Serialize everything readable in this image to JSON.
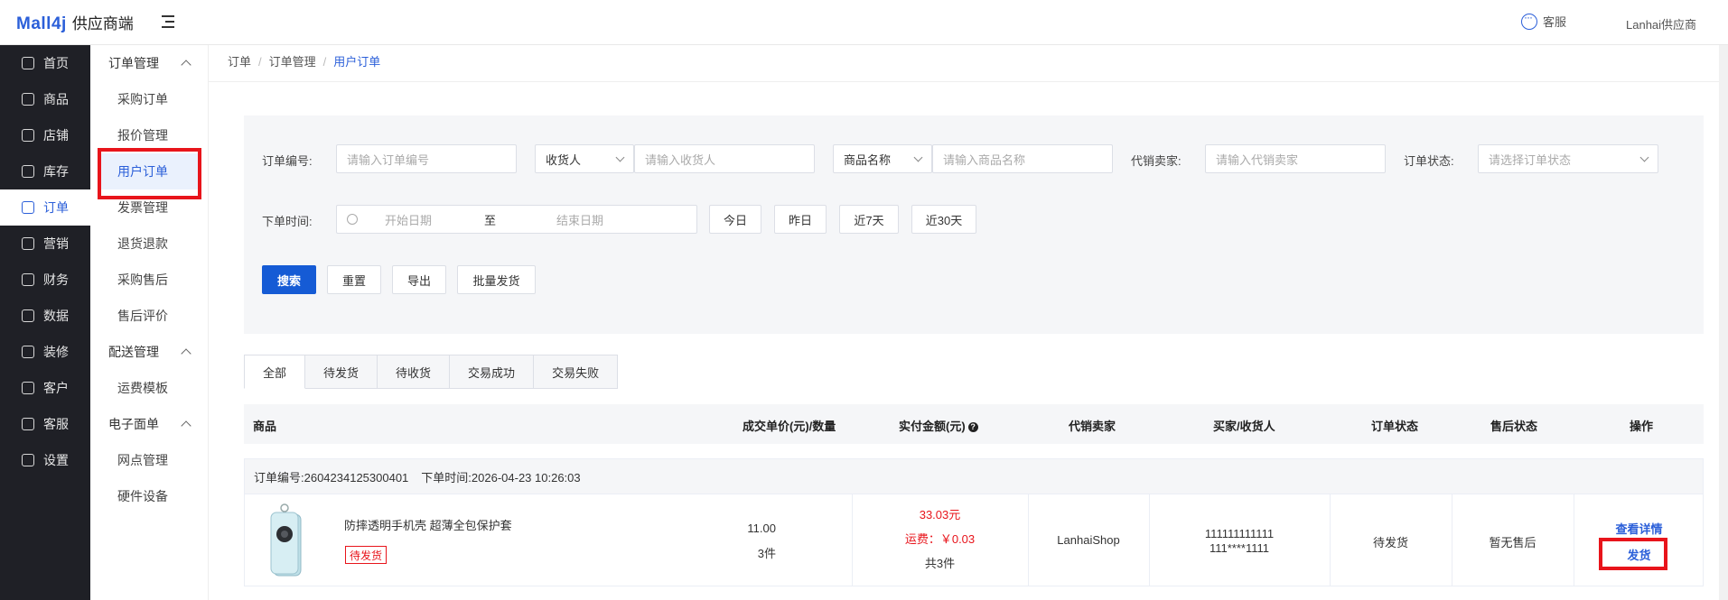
{
  "header": {
    "brand": "Mall4j",
    "brand_suffix": "供应商端",
    "service_label": "客服",
    "user_name": "Lanhai供应商"
  },
  "sidebar": {
    "items": [
      {
        "label": "首页",
        "icon": "home-icon"
      },
      {
        "label": "商品",
        "icon": "product-icon"
      },
      {
        "label": "店铺",
        "icon": "shop-icon"
      },
      {
        "label": "库存",
        "icon": "inventory-icon"
      },
      {
        "label": "订单",
        "icon": "order-icon",
        "active": true
      },
      {
        "label": "营销",
        "icon": "gift-icon"
      },
      {
        "label": "财务",
        "icon": "finance-icon"
      },
      {
        "label": "数据",
        "icon": "data-icon"
      },
      {
        "label": "装修",
        "icon": "decorate-icon"
      },
      {
        "label": "客户",
        "icon": "customer-icon"
      },
      {
        "label": "客服",
        "icon": "service-icon"
      },
      {
        "label": "设置",
        "icon": "settings-icon"
      }
    ]
  },
  "subnav": {
    "group1": "订单管理",
    "group1_items": [
      "采购订单",
      "报价管理",
      "用户订单",
      "发票管理",
      "退货退款",
      "采购售后",
      "售后评价"
    ],
    "group2": "配送管理",
    "group2_items": [
      "运费模板"
    ],
    "group3": "电子面单",
    "group3_items": [
      "网点管理",
      "硬件设备"
    ]
  },
  "breadcrumb": {
    "l1": "订单",
    "l2": "订单管理",
    "l3": "用户订单",
    "sep": "/"
  },
  "filters": {
    "order_no_label": "订单编号:",
    "order_no_placeholder": "请输入订单编号",
    "receiver_select": "收货人",
    "receiver_placeholder": "请输入收货人",
    "product_select": "商品名称",
    "product_placeholder": "请输入商品名称",
    "seller_label": "代销卖家:",
    "seller_placeholder": "请输入代销卖家",
    "status_label": "订单状态:",
    "status_placeholder": "请选择订单状态",
    "time_label": "下单时间:",
    "start_placeholder": "开始日期",
    "range_sep": "至",
    "end_placeholder": "结束日期",
    "quick": [
      "今日",
      "昨日",
      "近7天",
      "近30天"
    ],
    "search": "搜索",
    "reset": "重置",
    "export": "导出",
    "batch_ship": "批量发货"
  },
  "tabs": [
    "全部",
    "待发货",
    "待收货",
    "交易成功",
    "交易失败"
  ],
  "table": {
    "headers": {
      "product": "商品",
      "price_qty": "成交单价(元)/数量",
      "paid": "实付金额(元)",
      "seller": "代销卖家",
      "buyer": "买家/收货人",
      "status": "订单状态",
      "after_sale": "售后状态",
      "ops": "操作"
    },
    "order": {
      "order_no": "订单编号:2604234125300401",
      "order_time": "下单时间:2026-04-23 10:26:03",
      "product_name": "防摔透明手机壳 超薄全包保护套",
      "product_tag": "待发货",
      "unit_price": "11.00",
      "quantity": "3件",
      "paid_amount": "33.03元",
      "shipping": "运费：￥0.03",
      "total_items": "共3件",
      "seller": "LanhaiShop",
      "buyer_id": "111111111111",
      "buyer_phone": "111****1111",
      "status": "待发货",
      "after_sale": "暂无售后",
      "view_detail": "查看详情",
      "ship": "发货"
    }
  },
  "colors": {
    "accent": "#2b5fd9",
    "primary_button": "#155bd5",
    "highlight": "#e8141b",
    "sidebar_bg": "#1f2026"
  }
}
